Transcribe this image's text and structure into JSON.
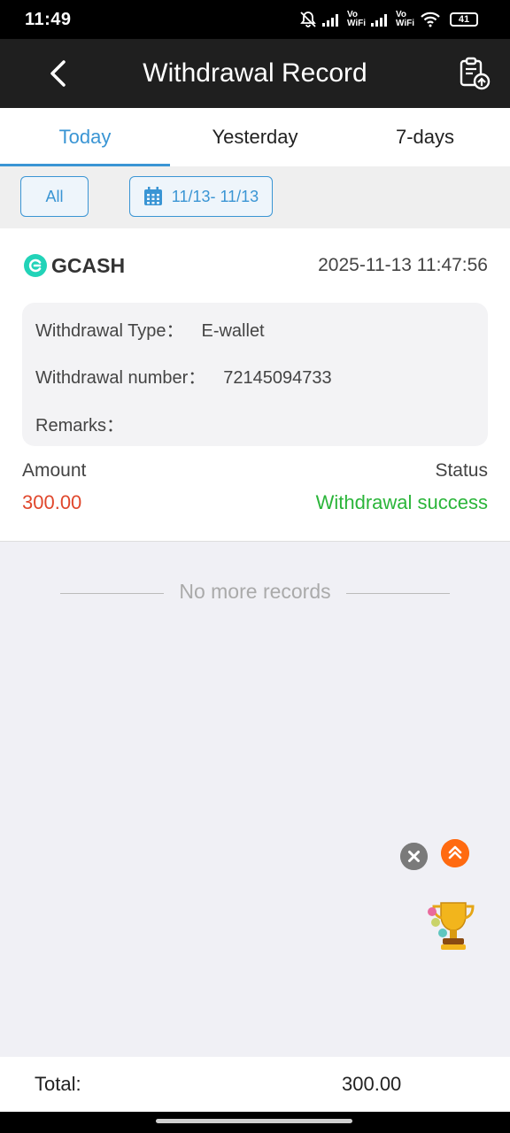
{
  "status_bar": {
    "time": "11:49",
    "vo_label_1": "Vo",
    "wifi_label_1": "WiFi",
    "vo_label_2": "Vo",
    "wifi_label_2": "WiFi",
    "battery": "41"
  },
  "header": {
    "title": "Withdrawal Record"
  },
  "tabs": [
    {
      "label": "Today",
      "active": true
    },
    {
      "label": "Yesterday",
      "active": false
    },
    {
      "label": "7-days",
      "active": false
    }
  ],
  "filters": {
    "all_label": "All",
    "date_range": "11/13- 11/13"
  },
  "record": {
    "method": "GCASH",
    "datetime": "2025-11-13 11:47:56",
    "type_label": "Withdrawal Type：",
    "type_value": "E-wallet",
    "number_label": "Withdrawal number：",
    "number_value": "72145094733",
    "remarks_label": "Remarks：",
    "remarks_value": "",
    "amount_label": "Amount",
    "amount_value": "300.00",
    "status_label": "Status",
    "status_value": "Withdrawal success"
  },
  "list_end_text": "No more records",
  "footer": {
    "total_label": "Total:",
    "total_value": "300.00"
  },
  "colors": {
    "accent": "#3a95d4",
    "amount": "#e0472c",
    "success": "#2bb53a",
    "header_bg": "#1f1f1f"
  }
}
